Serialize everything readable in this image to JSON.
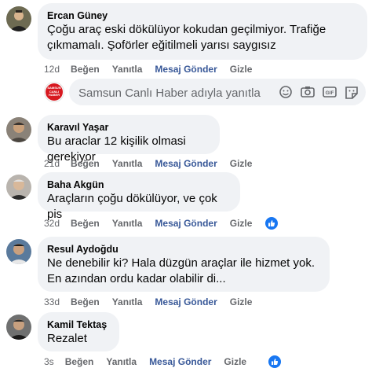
{
  "comments": [
    {
      "author": "Ercan Güney",
      "text": "Çoğu araç eski dökülüyor kokudan geçilmiyor. Trafiğe çıkmamalı. Şoförler eğitilmeli yarısı saygısız",
      "time": "12d",
      "like_label": "Beğen",
      "reply_label": "Yanıtla",
      "send_label": "Mesaj Gönder",
      "hide_label": "Gizle"
    },
    {
      "author": "Karavıl Yaşar",
      "text": "Bu araclar 12 kişilik olmasi gerekiyor",
      "time": "21d",
      "like_label": "Beğen",
      "reply_label": "Yanıtla",
      "send_label": "Mesaj Gönder",
      "hide_label": "Gizle"
    },
    {
      "author": "Baha Akgün",
      "text": "Araçların çoğu dökülüyor, ve çok pis",
      "time": "32d",
      "like_label": "Beğen",
      "reply_label": "Yanıtla",
      "send_label": "Mesaj Gönder",
      "hide_label": "Gizle"
    },
    {
      "author": "Resul Aydoğdu",
      "text": "Ne denebilir ki? Hala düzgün araçlar ile hizmet yok. En azından ordu kadar olabilir di...",
      "time": "33d",
      "like_label": "Beğen",
      "reply_label": "Yanıtla",
      "send_label": "Mesaj Gönder",
      "hide_label": "Gizle"
    },
    {
      "author": "Kamil Tektaş",
      "text": "Rezalet",
      "time": "3s",
      "like_label": "Beğen",
      "reply_label": "Yanıtla",
      "send_label": "Mesaj Gönder",
      "hide_label": "Gizle"
    }
  ],
  "reply_box": {
    "placeholder": "Samsun Canlı Haber adıyla yanıtla",
    "page_logo_text": [
      "SAMSUN",
      "CANLI",
      "HABER"
    ]
  },
  "colors": {
    "bubble": "#f0f2f5",
    "meta": "#65676b",
    "send_link": "#385898",
    "like_blue": "#1877f2",
    "logo_red": "#d71920"
  },
  "icons": [
    "emoji-icon",
    "camera-icon",
    "gif-icon",
    "sticker-icon",
    "like-reaction-icon"
  ]
}
